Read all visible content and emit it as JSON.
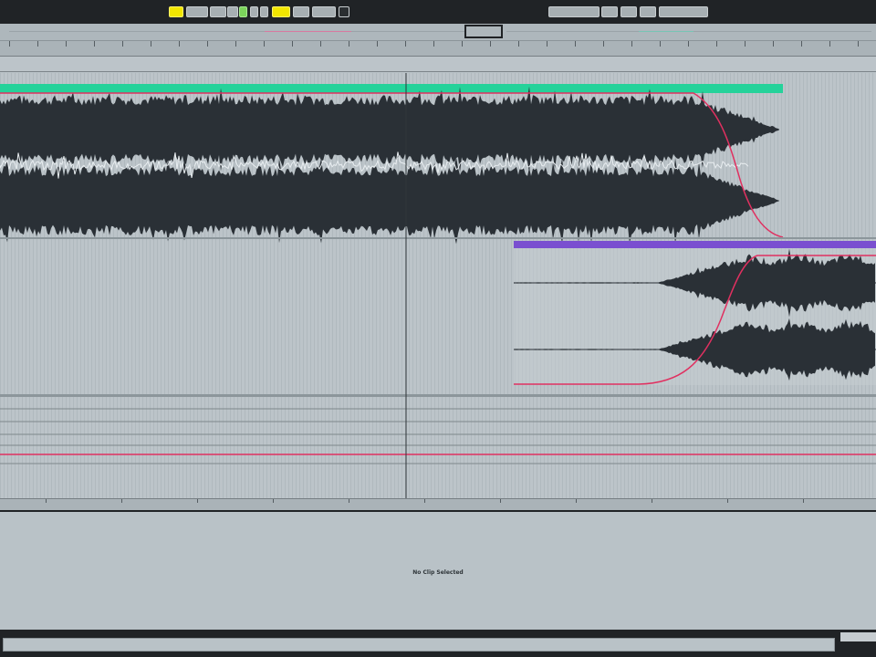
{
  "transport": {
    "left_buttons": [
      "",
      "",
      "",
      "",
      "",
      "",
      "",
      "",
      "",
      "",
      "",
      "",
      ""
    ],
    "right_buttons": [
      "",
      "",
      "",
      "",
      "",
      "",
      "",
      "",
      ""
    ]
  },
  "ruler_top_labels": [
    "",
    "",
    "",
    "",
    "",
    "",
    "",
    "",
    "",
    "",
    "",
    "",
    "",
    "",
    "",
    "",
    "",
    "",
    "",
    "",
    "",
    "",
    "",
    "",
    "",
    "",
    "",
    "",
    "",
    "",
    ""
  ],
  "ruler_bottom_labels": [
    "",
    "",
    "",
    "",
    "",
    "",
    "",
    "",
    "",
    "",
    "",
    ""
  ],
  "detail_view": {
    "message": "No Clip Selected"
  },
  "colors": {
    "clip1_header": "#25d29a",
    "clip2_header": "#7a4fd0",
    "waveform": "#2a3036",
    "automation": "#e03060",
    "background": "#b9c2c7"
  }
}
